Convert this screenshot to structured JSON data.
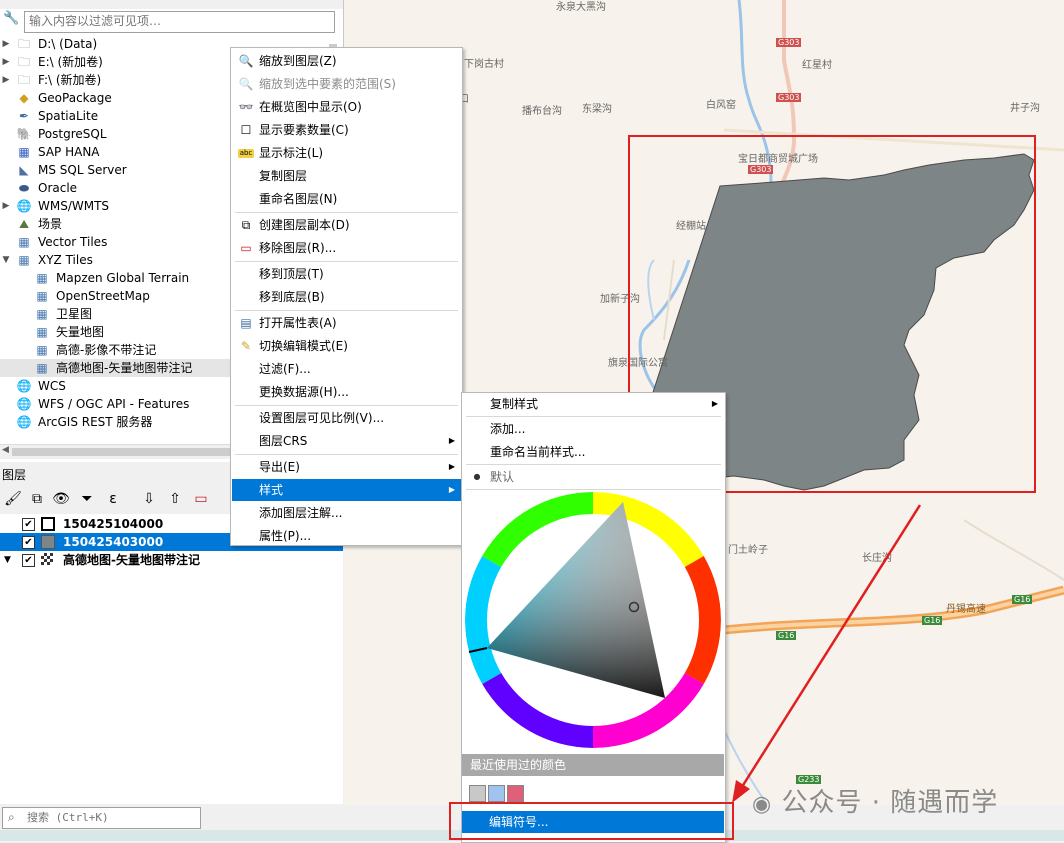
{
  "browser": {
    "filter_placeholder": "输入内容以过滤可见项…",
    "items": [
      {
        "label": "D:\\ (Data)",
        "icon": "folder-icon",
        "level": 0,
        "expandable": true
      },
      {
        "label": "E:\\ (新加卷)",
        "icon": "folder-icon",
        "level": 0,
        "expandable": true
      },
      {
        "label": "F:\\ (新加卷)",
        "icon": "folder-icon",
        "level": 0,
        "expandable": true
      },
      {
        "label": "GeoPackage",
        "icon": "geopackage-icon",
        "level": 0,
        "expandable": false
      },
      {
        "label": "SpatiaLite",
        "icon": "spatialite-icon",
        "level": 0,
        "expandable": false
      },
      {
        "label": "PostgreSQL",
        "icon": "postgresql-icon",
        "level": 0,
        "expandable": false
      },
      {
        "label": "SAP HANA",
        "icon": "sap-hana-icon",
        "level": 0,
        "expandable": false
      },
      {
        "label": "MS SQL Server",
        "icon": "mssql-icon",
        "level": 0,
        "expandable": false
      },
      {
        "label": "Oracle",
        "icon": "oracle-icon",
        "level": 0,
        "expandable": false
      },
      {
        "label": "WMS/WMTS",
        "icon": "globe-icon",
        "level": 0,
        "expandable": true
      },
      {
        "label": "场景",
        "icon": "scene-icon",
        "level": 0,
        "expandable": false
      },
      {
        "label": "Vector Tiles",
        "icon": "grid-icon",
        "level": 0,
        "expandable": false
      },
      {
        "label": "XYZ Tiles",
        "icon": "grid-icon",
        "level": 0,
        "expandable": true,
        "expanded": true
      },
      {
        "label": "Mapzen Global Terrain",
        "icon": "grid-icon",
        "level": 1,
        "expandable": false
      },
      {
        "label": "OpenStreetMap",
        "icon": "grid-icon",
        "level": 1,
        "expandable": false
      },
      {
        "label": "卫星图",
        "icon": "grid-icon",
        "level": 1,
        "expandable": false
      },
      {
        "label": "矢量地图",
        "icon": "grid-icon",
        "level": 1,
        "expandable": false
      },
      {
        "label": "高德-影像不带注记",
        "icon": "grid-icon",
        "level": 1,
        "expandable": false
      },
      {
        "label": "高德地图-矢量地图带注记",
        "icon": "grid-icon",
        "level": 1,
        "expandable": false,
        "selected": true
      },
      {
        "label": "WCS",
        "icon": "globe-icon",
        "level": 0,
        "expandable": false
      },
      {
        "label": "WFS / OGC API - Features",
        "icon": "globe-icon",
        "level": 0,
        "expandable": false
      },
      {
        "label": "ArcGIS REST 服务器",
        "icon": "globe-icon",
        "level": 0,
        "expandable": false
      }
    ]
  },
  "layers_panel": {
    "title": "图层",
    "layers": [
      {
        "label": "150425104000",
        "symbol": "polygon-outline",
        "checked": true,
        "selected": false
      },
      {
        "label": "150425403000",
        "symbol": "polygon-gray",
        "checked": true,
        "selected": true
      },
      {
        "label": "高德地图-矢量地图带注记",
        "symbol": "raster-tiles",
        "checked": true,
        "selected": false
      }
    ]
  },
  "search": {
    "placeholder": "搜索 (Ctrl+K)"
  },
  "context_menu": {
    "items": [
      {
        "label": "缩放到图层(Z)",
        "icon": "zoom-layer-icon"
      },
      {
        "label": "缩放到选中要素的范围(S)",
        "icon": "zoom-selection-icon",
        "disabled": true
      },
      {
        "label": "在概览图中显示(O)",
        "icon": "overview-icon"
      },
      {
        "label": "显示要素数量(C)",
        "icon": "checkbox-icon"
      },
      {
        "label": "显示标注(L)",
        "icon": "label-icon"
      },
      {
        "label": "复制图层",
        "icon": ""
      },
      {
        "label": "重命名图层(N)",
        "icon": ""
      },
      {
        "sep": true
      },
      {
        "label": "创建图层副本(D)",
        "icon": "duplicate-icon"
      },
      {
        "label": "移除图层(R)...",
        "icon": "remove-icon"
      },
      {
        "sep": true
      },
      {
        "label": "移到顶层(T)",
        "icon": ""
      },
      {
        "label": "移到底层(B)",
        "icon": ""
      },
      {
        "sep": true
      },
      {
        "label": "打开属性表(A)",
        "icon": "table-icon"
      },
      {
        "label": "切换编辑模式(E)",
        "icon": "pencil-icon"
      },
      {
        "label": "过滤(F)...",
        "icon": ""
      },
      {
        "label": "更换数据源(H)...",
        "icon": ""
      },
      {
        "sep": true
      },
      {
        "label": "设置图层可见比例(V)...",
        "icon": ""
      },
      {
        "label": "图层CRS",
        "icon": "",
        "submenu": true
      },
      {
        "sep": true
      },
      {
        "label": "导出(E)",
        "icon": "",
        "submenu": true
      },
      {
        "label": "样式",
        "icon": "",
        "submenu": true,
        "highlighted": true
      },
      {
        "label": "添加图层注解...",
        "icon": ""
      },
      {
        "label": "属性(P)...",
        "icon": ""
      }
    ]
  },
  "style_submenu": {
    "copy_style": "复制样式",
    "add": "添加...",
    "rename": "重命名当前样式...",
    "default_style": "默认",
    "recent_colors_label": "最近使用过的颜色",
    "recent_colors": [
      "#c8c8c8",
      "#a0c4f0",
      "#e0607a"
    ],
    "edit_symbol": "编辑符号..."
  },
  "map": {
    "polygon_color": "#7d8587",
    "labels": [
      {
        "text": "永泉大黑沟",
        "id": "lbl-yongquan"
      },
      {
        "text": "下岗古村",
        "id": "lbl-xiagang"
      },
      {
        "text": "G303",
        "id": "lbl-g303a"
      },
      {
        "text": "红星村",
        "id": "lbl-hongxing"
      },
      {
        "text": "口",
        "id": "lbl-kou"
      },
      {
        "text": "播布台沟",
        "id": "lbl-bobu"
      },
      {
        "text": "东梁沟",
        "id": "lbl-dongliang"
      },
      {
        "text": "白风窑",
        "id": "lbl-baifeng"
      },
      {
        "text": "G303",
        "id": "lbl-g303b"
      },
      {
        "text": "井子沟",
        "id": "lbl-jingzi"
      },
      {
        "text": "宝日都商贸城广场",
        "id": "lbl-baori"
      },
      {
        "text": "G303",
        "id": "lbl-g303c"
      },
      {
        "text": "经棚站",
        "id": "lbl-jingpeng"
      },
      {
        "text": "加新子沟",
        "id": "lbl-jiaxin"
      },
      {
        "text": "旗泉国际公寓",
        "id": "lbl-qiquan"
      },
      {
        "text": "门土岭子",
        "id": "lbl-mentu"
      },
      {
        "text": "长庄沟",
        "id": "lbl-changzhuang"
      },
      {
        "text": "G16",
        "id": "lbl-g16a"
      },
      {
        "text": "G16",
        "id": "lbl-g16b"
      },
      {
        "text": "丹锡高速",
        "id": "lbl-danxi"
      },
      {
        "text": "G16",
        "id": "lbl-g16c"
      },
      {
        "text": "G233",
        "id": "lbl-g233"
      }
    ]
  },
  "watermark": "公众号 · 随遇而学"
}
